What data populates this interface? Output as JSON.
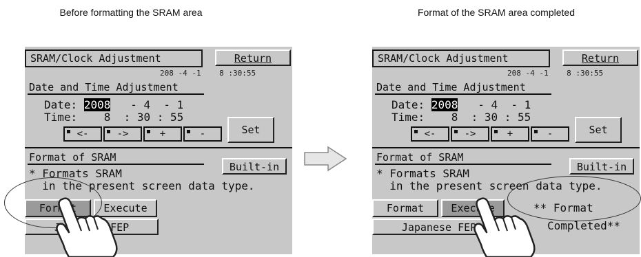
{
  "captions": {
    "left": "Before formatting the SRAM area",
    "right": "Format of the SRAM area completed"
  },
  "screen": {
    "title": "SRAM/Clock Adjustment",
    "return_label": "Return",
    "clock_readout": "208 -4 -1    8 :30:55",
    "date_time_section": "Date and Time Adjustment",
    "date_label": "Date:",
    "date_year": "2008",
    "date_rest": "   - 4  - 1",
    "time_label": "Time:",
    "time_value": "    8  : 30 : 55",
    "btn_left": "<-",
    "btn_right": "->",
    "btn_plus": "+",
    "btn_minus": "-",
    "set_label": "Set",
    "format_section": "Format of SRAM",
    "builtin_label": "Built-in",
    "desc_line1": "* Formats SRAM",
    "desc_line2": "  in the present screen data type.",
    "format_btn": "Format",
    "execute_btn": "Execute",
    "fep_btn": "Japanese FEP",
    "completed_line1": "** Format",
    "completed_line2": "Completed**"
  },
  "icons": {
    "hand": "pointing-hand-icon",
    "arrow": "right-arrow-icon"
  },
  "colors": {
    "screen_bg": "#c8c8c8",
    "highlight": "#000000"
  }
}
